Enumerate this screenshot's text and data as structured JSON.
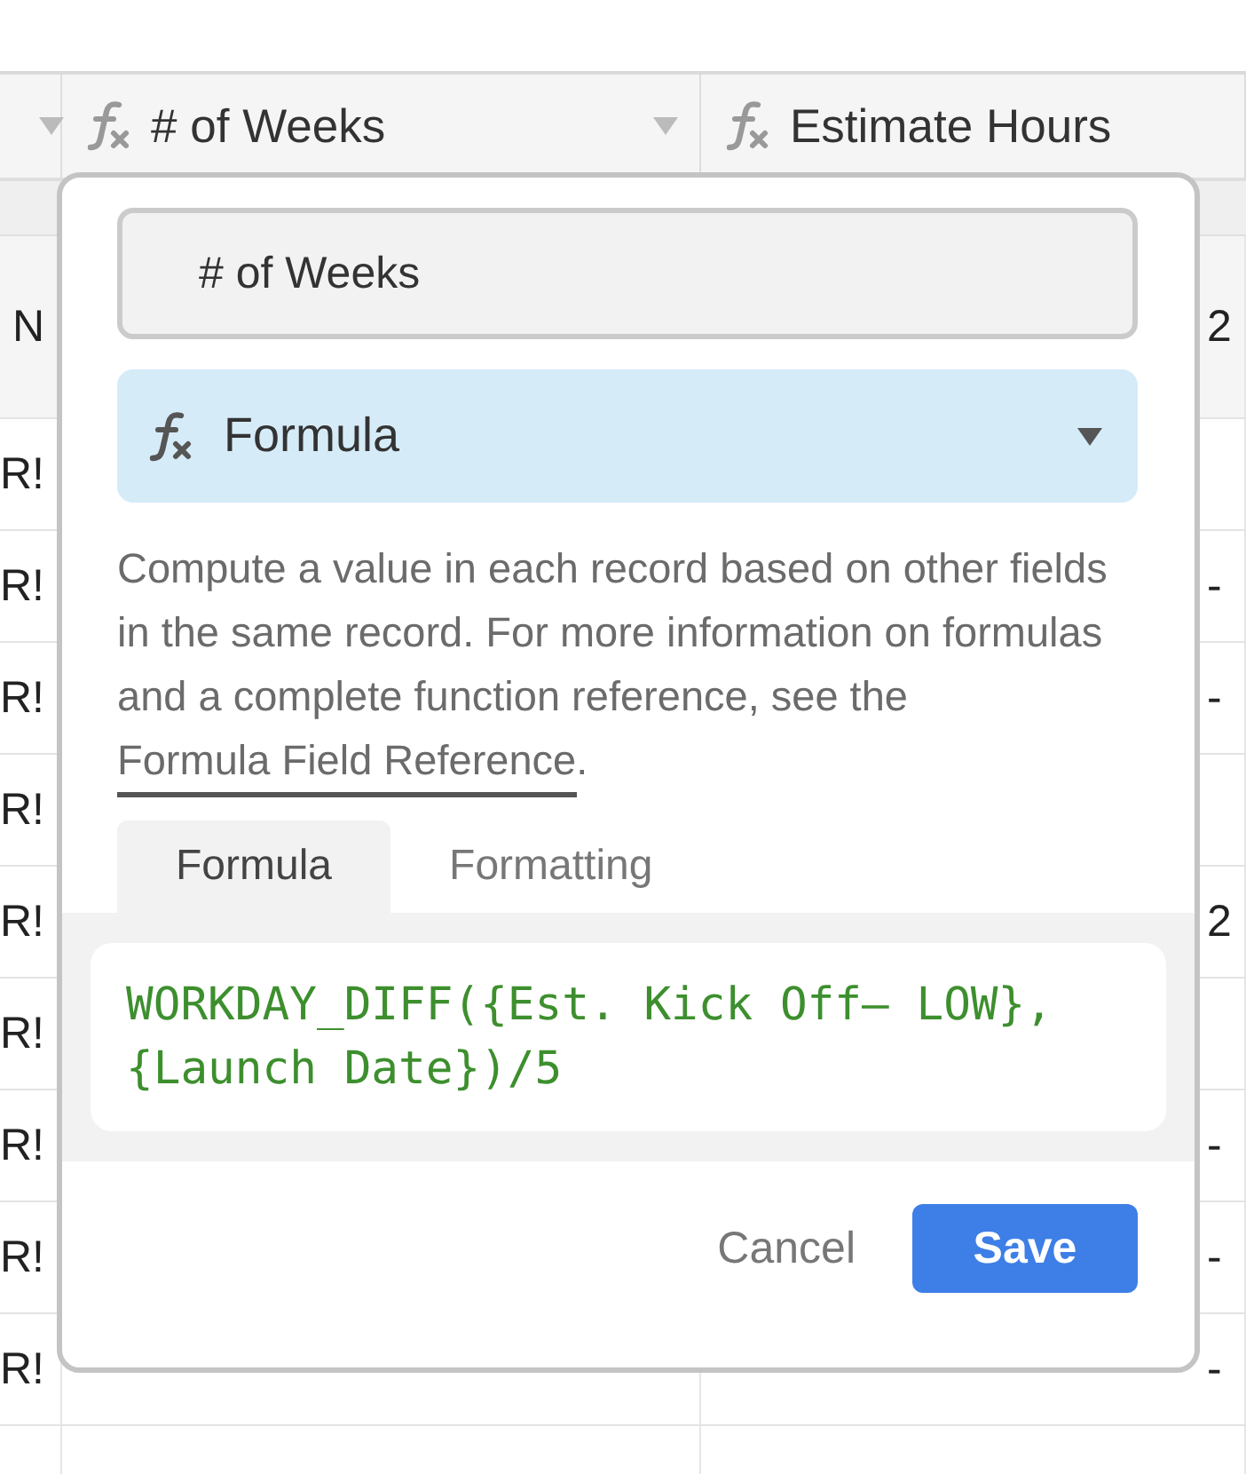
{
  "table": {
    "columns": [
      {
        "kind": "cut"
      },
      {
        "kind": "formula",
        "title": "# of Weeks"
      },
      {
        "kind": "formula",
        "title": "Estimate Hours"
      }
    ],
    "rows": [
      {
        "kind": "summary",
        "column_1": "N",
        "column_3": "2"
      },
      {
        "kind": "record",
        "column_1": "R!"
      },
      {
        "kind": "record",
        "column_1": "R!",
        "column_3": "-"
      },
      {
        "kind": "record",
        "column_1": "R!",
        "column_3": "-"
      },
      {
        "kind": "record",
        "column_1": "R!"
      },
      {
        "kind": "record",
        "column_1": "R!",
        "column_3": "2"
      },
      {
        "kind": "record",
        "column_1": "R!"
      },
      {
        "kind": "record",
        "column_1": "R!",
        "column_3": "-"
      },
      {
        "kind": "record",
        "column_1": "R!",
        "column_3": "-"
      },
      {
        "kind": "record",
        "column_1": "R!",
        "column_3": "-"
      }
    ]
  },
  "field_editor": {
    "name_field": {
      "value": "# of Weeks"
    },
    "type_select": {
      "value": "Formula"
    },
    "description": "Compute a value in each record based on other fields in the same record. For more information on formulas and a complete function reference, see the ",
    "link": "Formula Field Reference",
    "description_end": ".",
    "tabs": [
      {
        "label": "Formula",
        "selected": true
      },
      {
        "label": "Formatting",
        "selected": false
      }
    ],
    "formula": "WORKDAY_DIFF({Est. Kick Off– LOW},\n{Launch Date})/5",
    "buttons": [
      {
        "kind": "cancel",
        "label": "Cancel"
      },
      {
        "kind": "save",
        "label": "Save"
      }
    ]
  }
}
